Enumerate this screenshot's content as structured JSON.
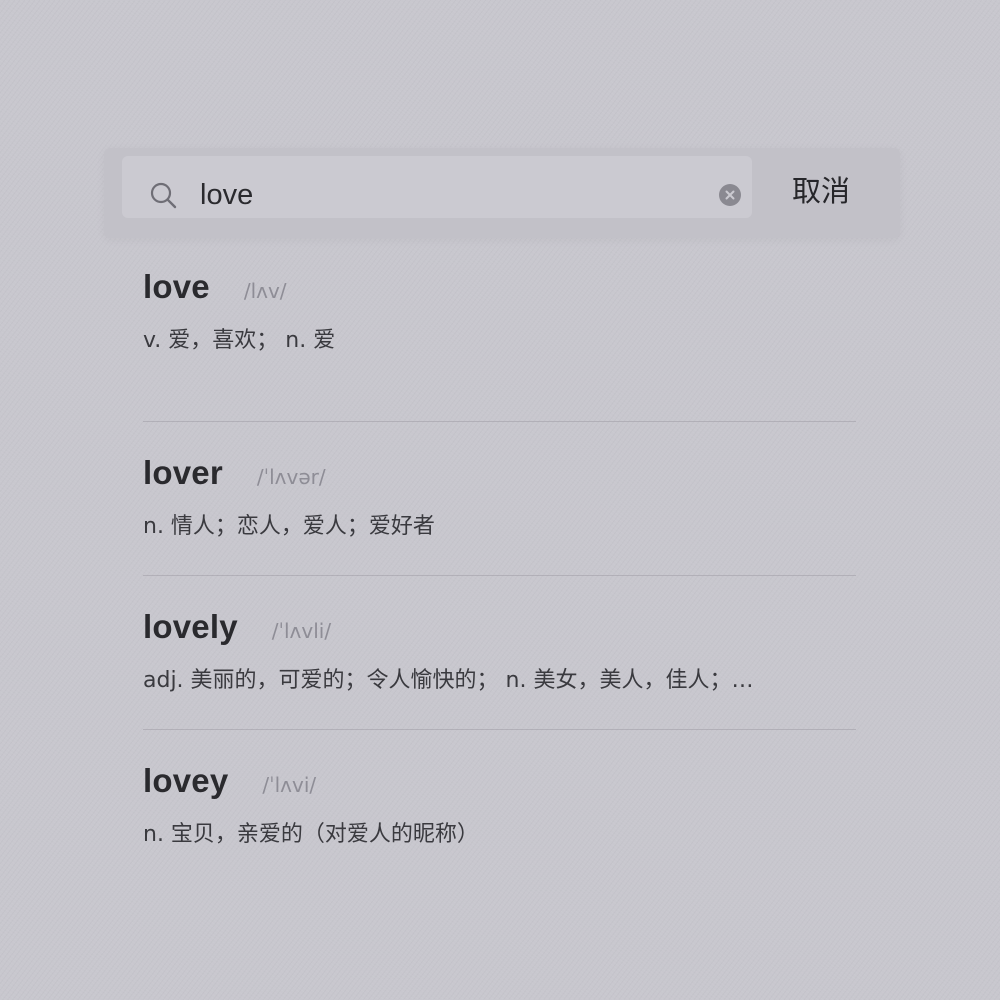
{
  "search": {
    "query": "love",
    "cancel_label": "取消"
  },
  "results": [
    {
      "word": "love",
      "phonetic": "/lʌv/",
      "definition": "v. 爱，喜欢；  n. 爱"
    },
    {
      "word": "lover",
      "phonetic": "/ˈlʌvər/",
      "definition": "n. 情人；恋人，爱人；爱好者"
    },
    {
      "word": "lovely",
      "phonetic": "/ˈlʌvli/",
      "definition": "adj. 美丽的，可爱的；令人愉快的；  n. 美女，美人，佳人；…"
    },
    {
      "word": "lovey",
      "phonetic": "/ˈlʌvi/",
      "definition": "n. 宝贝，亲爱的（对爱人的昵称）"
    }
  ],
  "icons": {
    "search": "search-icon",
    "clear": "clear-icon"
  },
  "colors": {
    "background": "#c8c7ce",
    "search_bar": "#c2c1c8",
    "text": "#2a2a2e",
    "phonetic": "#8e8d96"
  }
}
